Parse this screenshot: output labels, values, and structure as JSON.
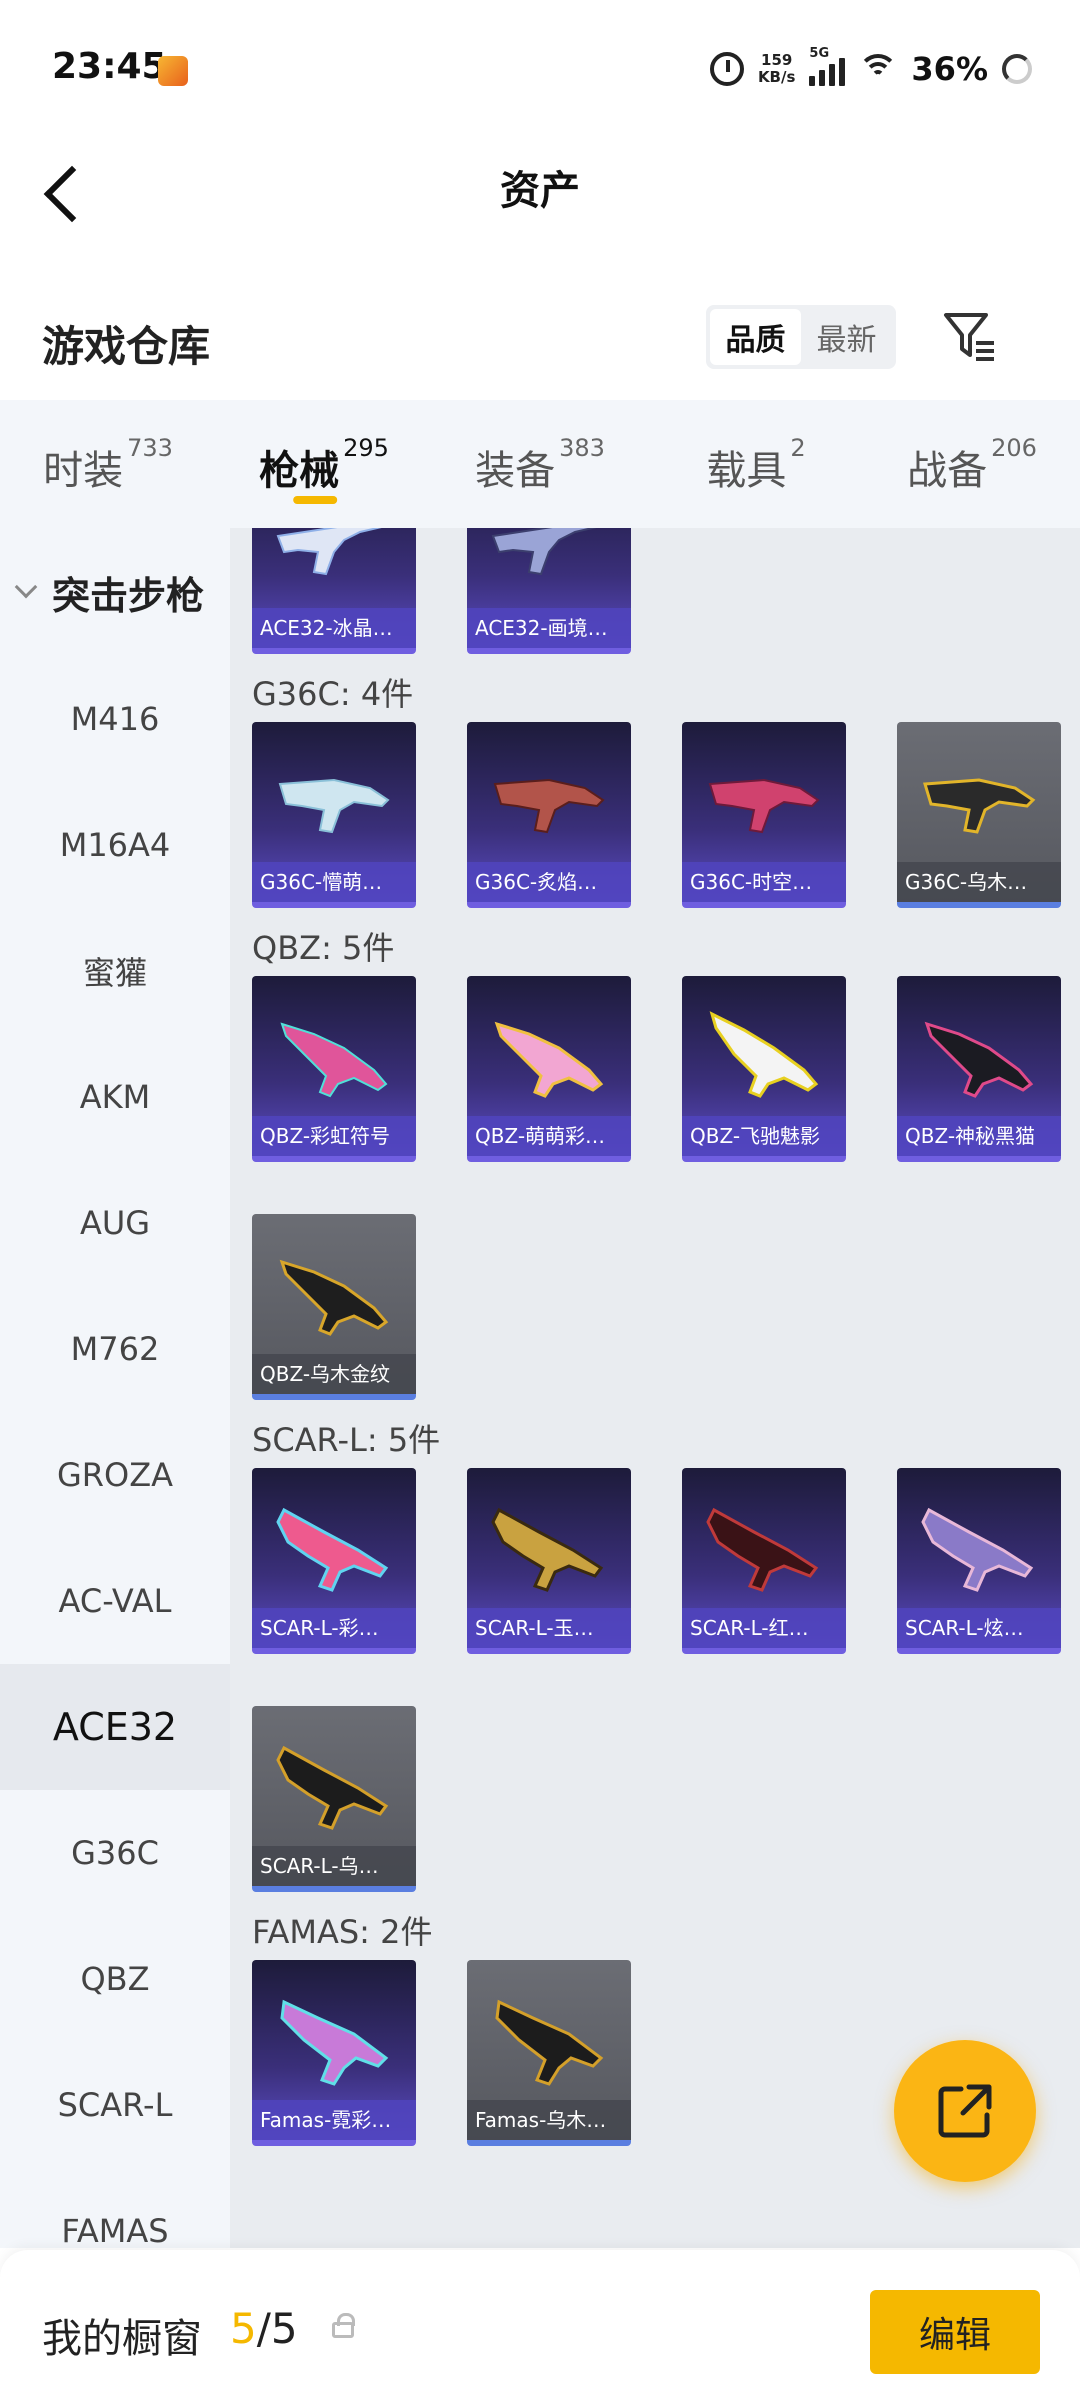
{
  "status_bar": {
    "time": "23:45",
    "net_speed_value": "159",
    "net_speed_unit": "KB/s",
    "network_type": "5G",
    "battery": "36%"
  },
  "header": {
    "title": "资产"
  },
  "warehouse": {
    "title": "游戏仓库",
    "sort_options": [
      "品质",
      "最新"
    ],
    "active_sort": "品质"
  },
  "tabs": [
    {
      "label": "时装",
      "count": "733"
    },
    {
      "label": "枪械",
      "count": "295",
      "active": true
    },
    {
      "label": "装备",
      "count": "383"
    },
    {
      "label": "载具",
      "count": "2"
    },
    {
      "label": "战备",
      "count": "206"
    }
  ],
  "sidebar": {
    "group": "突击步枪",
    "items": [
      "M416",
      "M16A4",
      "蜜獾",
      "AKM",
      "AUG",
      "M762",
      "GROZA",
      "AC-VAL",
      "ACE32",
      "G36C",
      "QBZ",
      "SCAR-L",
      "FAMAS"
    ],
    "active_item": "ACE32"
  },
  "content": {
    "ace32_items": [
      "ACE32-冰晶…",
      "ACE32-画境…"
    ],
    "g36c_header": "G36C: 4件",
    "g36c_items": [
      "G36C-懵萌…",
      "G36C-炙焰…",
      "G36C-时空…",
      "G36C-乌木…"
    ],
    "qbz_header": "QBZ: 5件",
    "qbz_items": [
      "QBZ-彩虹符号",
      "QBZ-萌萌彩…",
      "QBZ-飞驰魅影",
      "QBZ-神秘黑猫",
      "QBZ-乌木金纹"
    ],
    "scarl_header": "SCAR-L: 5件",
    "scarl_items": [
      "SCAR-L-彩…",
      "SCAR-L-玉…",
      "SCAR-L-红…",
      "SCAR-L-炫…",
      "SCAR-L-乌…"
    ],
    "famas_header": "FAMAS: 2件",
    "famas_items": [
      "Famas-霓彩…",
      "Famas-乌木…"
    ]
  },
  "bottom_bar": {
    "showcase_label": "我的橱窗",
    "showcase_current": "5",
    "showcase_sep_total": "/5",
    "edit_label": "编辑"
  },
  "colors": {
    "accent": "#f5b800",
    "card_purple": "#5b4cc4",
    "card_gray": "#56585f"
  }
}
